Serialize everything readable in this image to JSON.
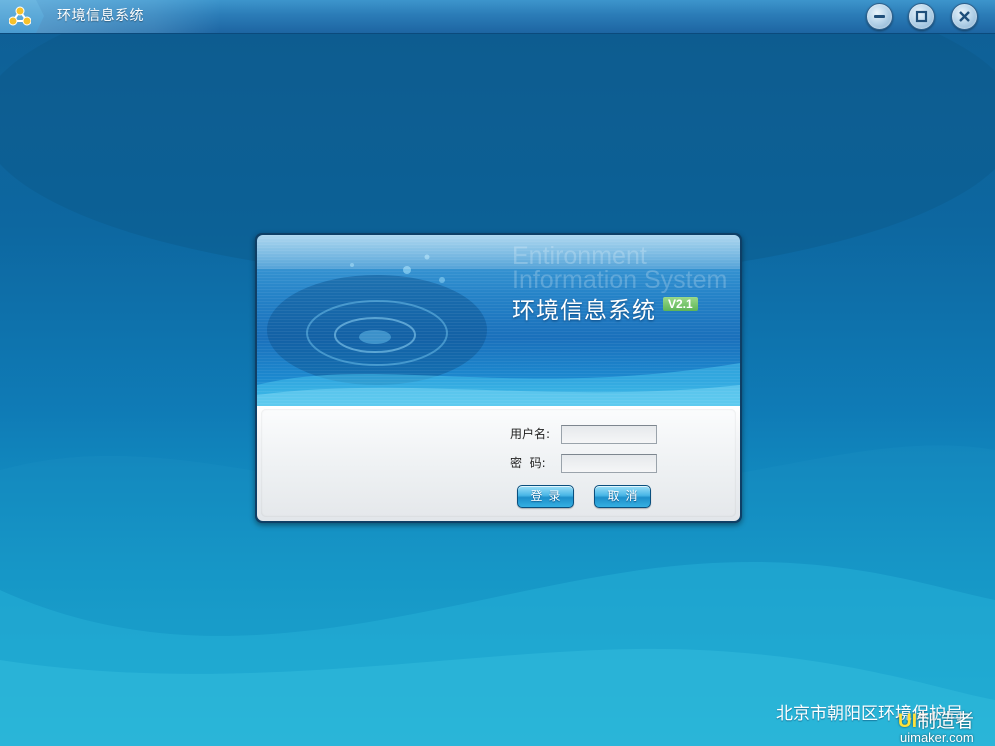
{
  "window": {
    "title": "环境信息系统",
    "logo_icon": "three-dots-logo-icon",
    "controls": {
      "minimize_icon": "minimize-icon",
      "maximize_icon": "maximize-icon",
      "close_icon": "close-icon"
    }
  },
  "banner": {
    "english_line1": "Entironment",
    "english_line2": "Information System",
    "chinese_title": "环境信息系统",
    "version": "V2.1"
  },
  "login_form": {
    "username_label": "用户名:",
    "username_value": "",
    "password_label": "密  码:",
    "password_value": "",
    "login_button": "登录",
    "cancel_button": "取消"
  },
  "footer": {
    "organization": "北京市朝阳区环境保护局"
  },
  "watermark": {
    "prefix": "UI",
    "suffix": "制造者",
    "url": "uimaker.com"
  },
  "colors": {
    "background_top": "#0f5f95",
    "background_bottom": "#1eb6d6",
    "titlebar": "#2b7cb7",
    "button_blue": "#35b0e2",
    "version_green": "#5eb556"
  }
}
